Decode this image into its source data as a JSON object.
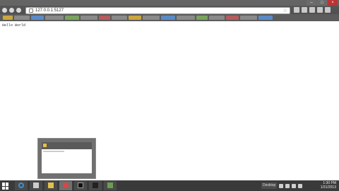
{
  "browser": {
    "url": "127.0.0.1:5127",
    "window_controls": {
      "minimize": "–",
      "maximize": "□",
      "close": "×"
    },
    "nav_icons": [
      "back-icon",
      "forward-icon",
      "reload-icon"
    ],
    "star_icon": "☆"
  },
  "page": {
    "text": "Hello World"
  },
  "taskbar": {
    "desktop_label": "Desktop",
    "clock_time": "1:30 PM",
    "clock_date": "1/31/2013"
  }
}
